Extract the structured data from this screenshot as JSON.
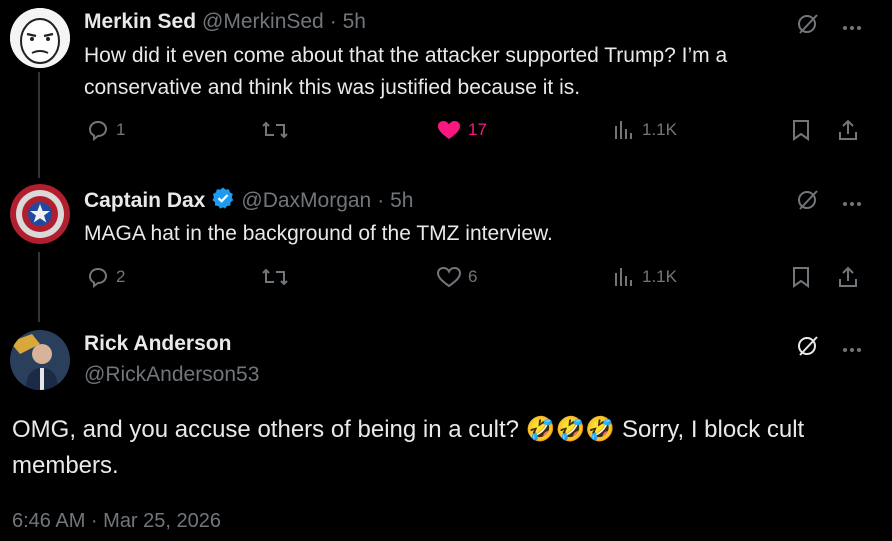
{
  "tweets": [
    {
      "name": "Merkin Sed",
      "handle": "@MerkinSed",
      "time": "· 5h",
      "text": "How did it even come about that the attacker supported Trump? I’m a conservative and think this was justified because it is.",
      "replies": "1",
      "likes": "17",
      "views": "1.1K",
      "liked": true
    },
    {
      "name": "Captain Dax",
      "handle": "@DaxMorgan",
      "time": "· 5h",
      "text": "MAGA hat in the background of the TMZ interview.",
      "replies": "2",
      "likes": "6",
      "views": "1.1K",
      "liked": false
    }
  ],
  "main": {
    "name": "Rick Anderson",
    "handle": "@RickAnderson53",
    "text_part1": "OMG, and you accuse others of being in a cult? ",
    "emojis": "🤣🤣🤣",
    "text_part2": " Sorry, I block cult members.",
    "timestamp": "6:46 AM · Mar 25, 2026"
  },
  "colors": {
    "like": "#f91880",
    "muted": "#71767b",
    "verified": "#1d9bf0"
  }
}
